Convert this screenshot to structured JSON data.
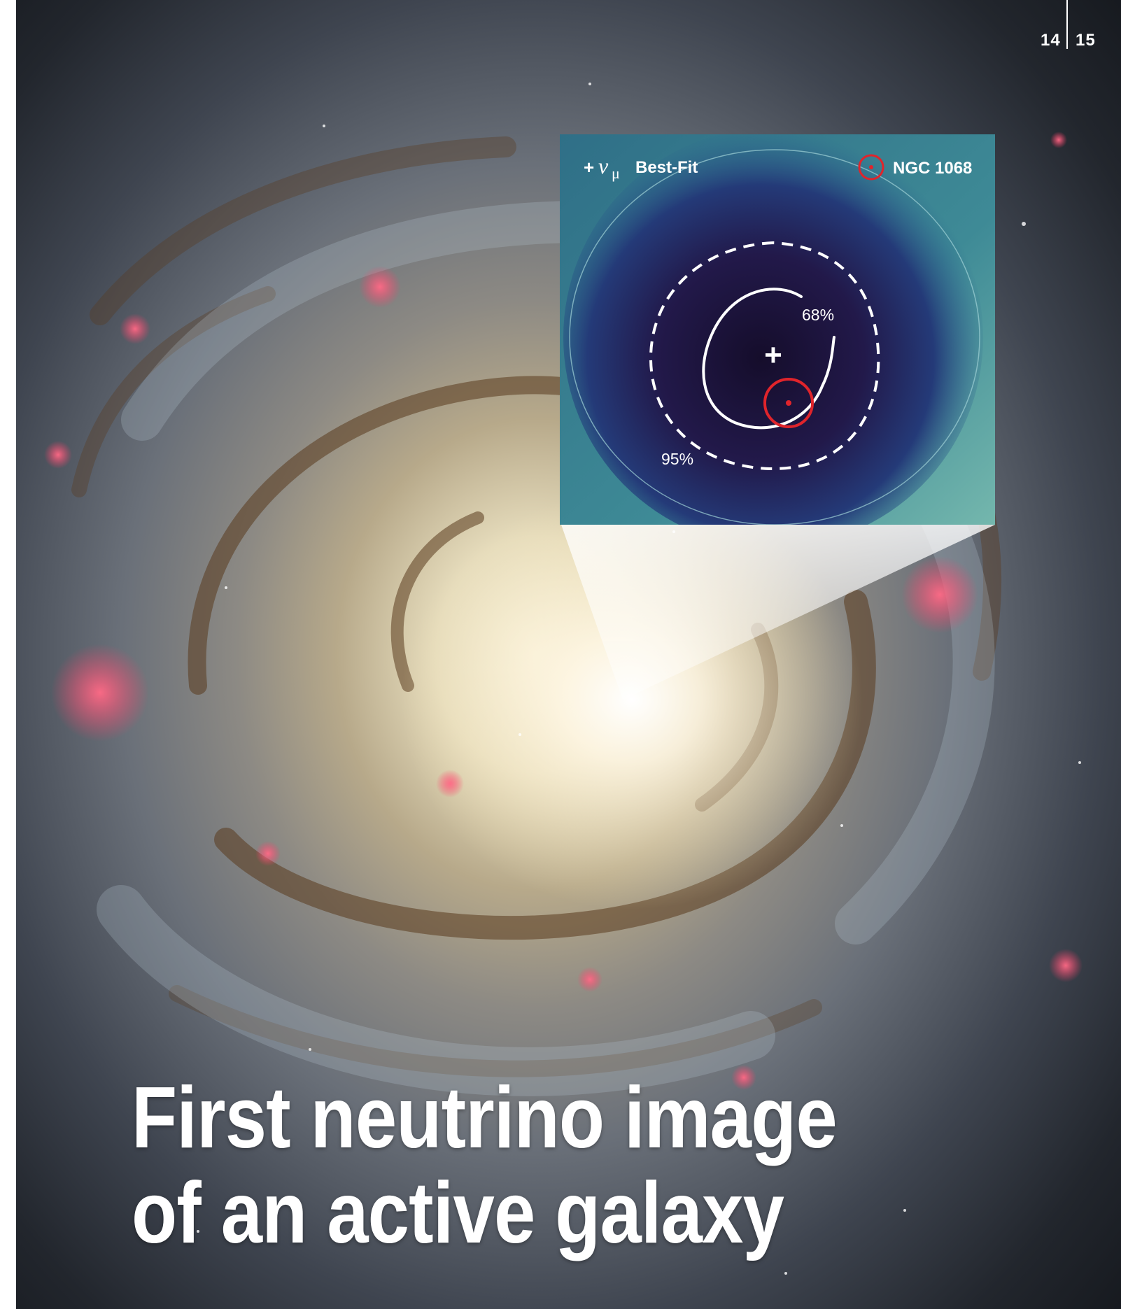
{
  "page_numbers": {
    "left": "14",
    "right": "15"
  },
  "inset_map": {
    "legend_best_fit": {
      "symbol": "+",
      "text": "Best-Fit",
      "subscript_symbol": "ν",
      "subscript_index": "μ"
    },
    "legend_source": {
      "text": "NGC 1068"
    },
    "contour_68_label": "68%",
    "contour_95_label": "95%",
    "best_fit_marker": "+"
  },
  "headline": {
    "line1": "First neutrino image",
    "line2": "of an active galaxy"
  },
  "colors": {
    "source_marker": "#e0242b",
    "contour_lines": "#ffffff",
    "headline_text": "#ffffff"
  }
}
